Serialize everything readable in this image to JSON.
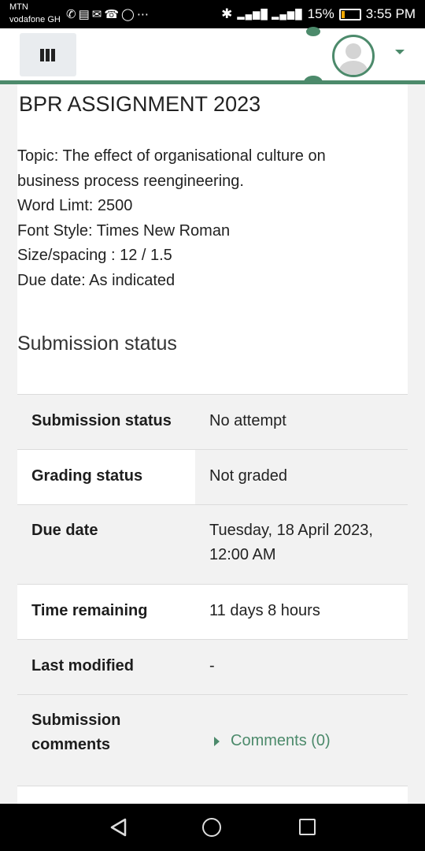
{
  "status_bar": {
    "carrier1": "MTN",
    "carrier2": "vodafone GH",
    "notification_icons": [
      "whatsapp-icon",
      "message-icon",
      "gmail-icon",
      "phone-icon",
      "opera-icon",
      "more-icon"
    ],
    "battery": "15%",
    "time": "3:55 PM"
  },
  "navbar": {
    "menu_icon": "hamburger-icon",
    "user_icon": "avatar-icon",
    "user_menu_icon": "caret-down-icon",
    "accent_color": "#4c8a6b"
  },
  "assignment": {
    "title": "BPR ASSIGNMENT 2023",
    "description": [
      "Topic: The effect of organisational culture on",
      "business process reengineering.",
      "Word Limt: 2500",
      "Font Style: Times New Roman",
      "Size/spacing : 12 / 1.5",
      "Due date: As indicated"
    ]
  },
  "submission": {
    "heading": "Submission status",
    "rows": [
      {
        "label": "Submission status",
        "value": "No attempt"
      },
      {
        "label": "Grading status",
        "value": "Not graded"
      },
      {
        "label": "Due date",
        "value_line1": "Tuesday, 18 April 2023,",
        "value_line2": "12:00 AM"
      },
      {
        "label": "Time remaining",
        "value": "11 days 8 hours"
      },
      {
        "label": "Last modified",
        "value": "-"
      },
      {
        "label_line1": "Submission",
        "label_line2": "comments",
        "value": "Comments (0)"
      }
    ]
  }
}
